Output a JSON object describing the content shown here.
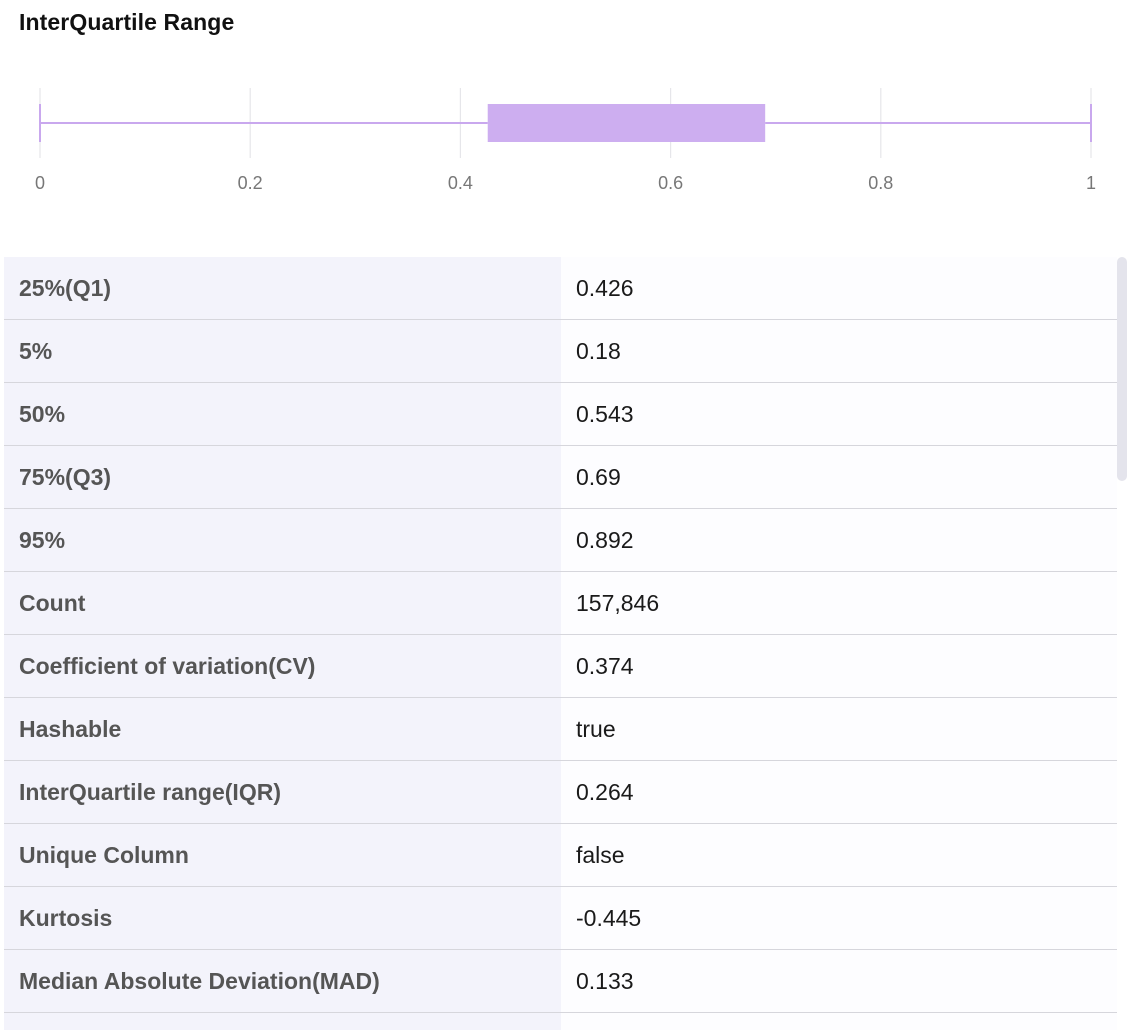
{
  "section": {
    "title": "InterQuartile Range"
  },
  "chart_data": {
    "type": "box",
    "min": 0,
    "q1": 0.426,
    "median": 0.543,
    "q3": 0.69,
    "max": 1,
    "xlim": [
      0,
      1
    ],
    "ticks": [
      0,
      0.2,
      0.4,
      0.6,
      0.8,
      1
    ],
    "tick_labels": [
      "0",
      "0.2",
      "0.4",
      "0.6",
      "0.8",
      "1"
    ],
    "grid": true,
    "color": "#cdaef0",
    "whisker_color": "#c9a8ee"
  },
  "stats": [
    {
      "label": "25%(Q1)",
      "value": "0.426"
    },
    {
      "label": "5%",
      "value": "0.18"
    },
    {
      "label": "50%",
      "value": "0.543"
    },
    {
      "label": "75%(Q3)",
      "value": "0.69"
    },
    {
      "label": "95%",
      "value": "0.892"
    },
    {
      "label": "Count",
      "value": "157,846"
    },
    {
      "label": "Coefficient of variation(CV)",
      "value": "0.374"
    },
    {
      "label": "Hashable",
      "value": "true"
    },
    {
      "label": "InterQuartile range(IQR)",
      "value": "0.264"
    },
    {
      "label": "Unique Column",
      "value": "false"
    },
    {
      "label": "Kurtosis",
      "value": "-0.445"
    },
    {
      "label": "Median Absolute Deviation(MAD)",
      "value": "0.133"
    },
    {
      "label": "",
      "value": ""
    }
  ]
}
